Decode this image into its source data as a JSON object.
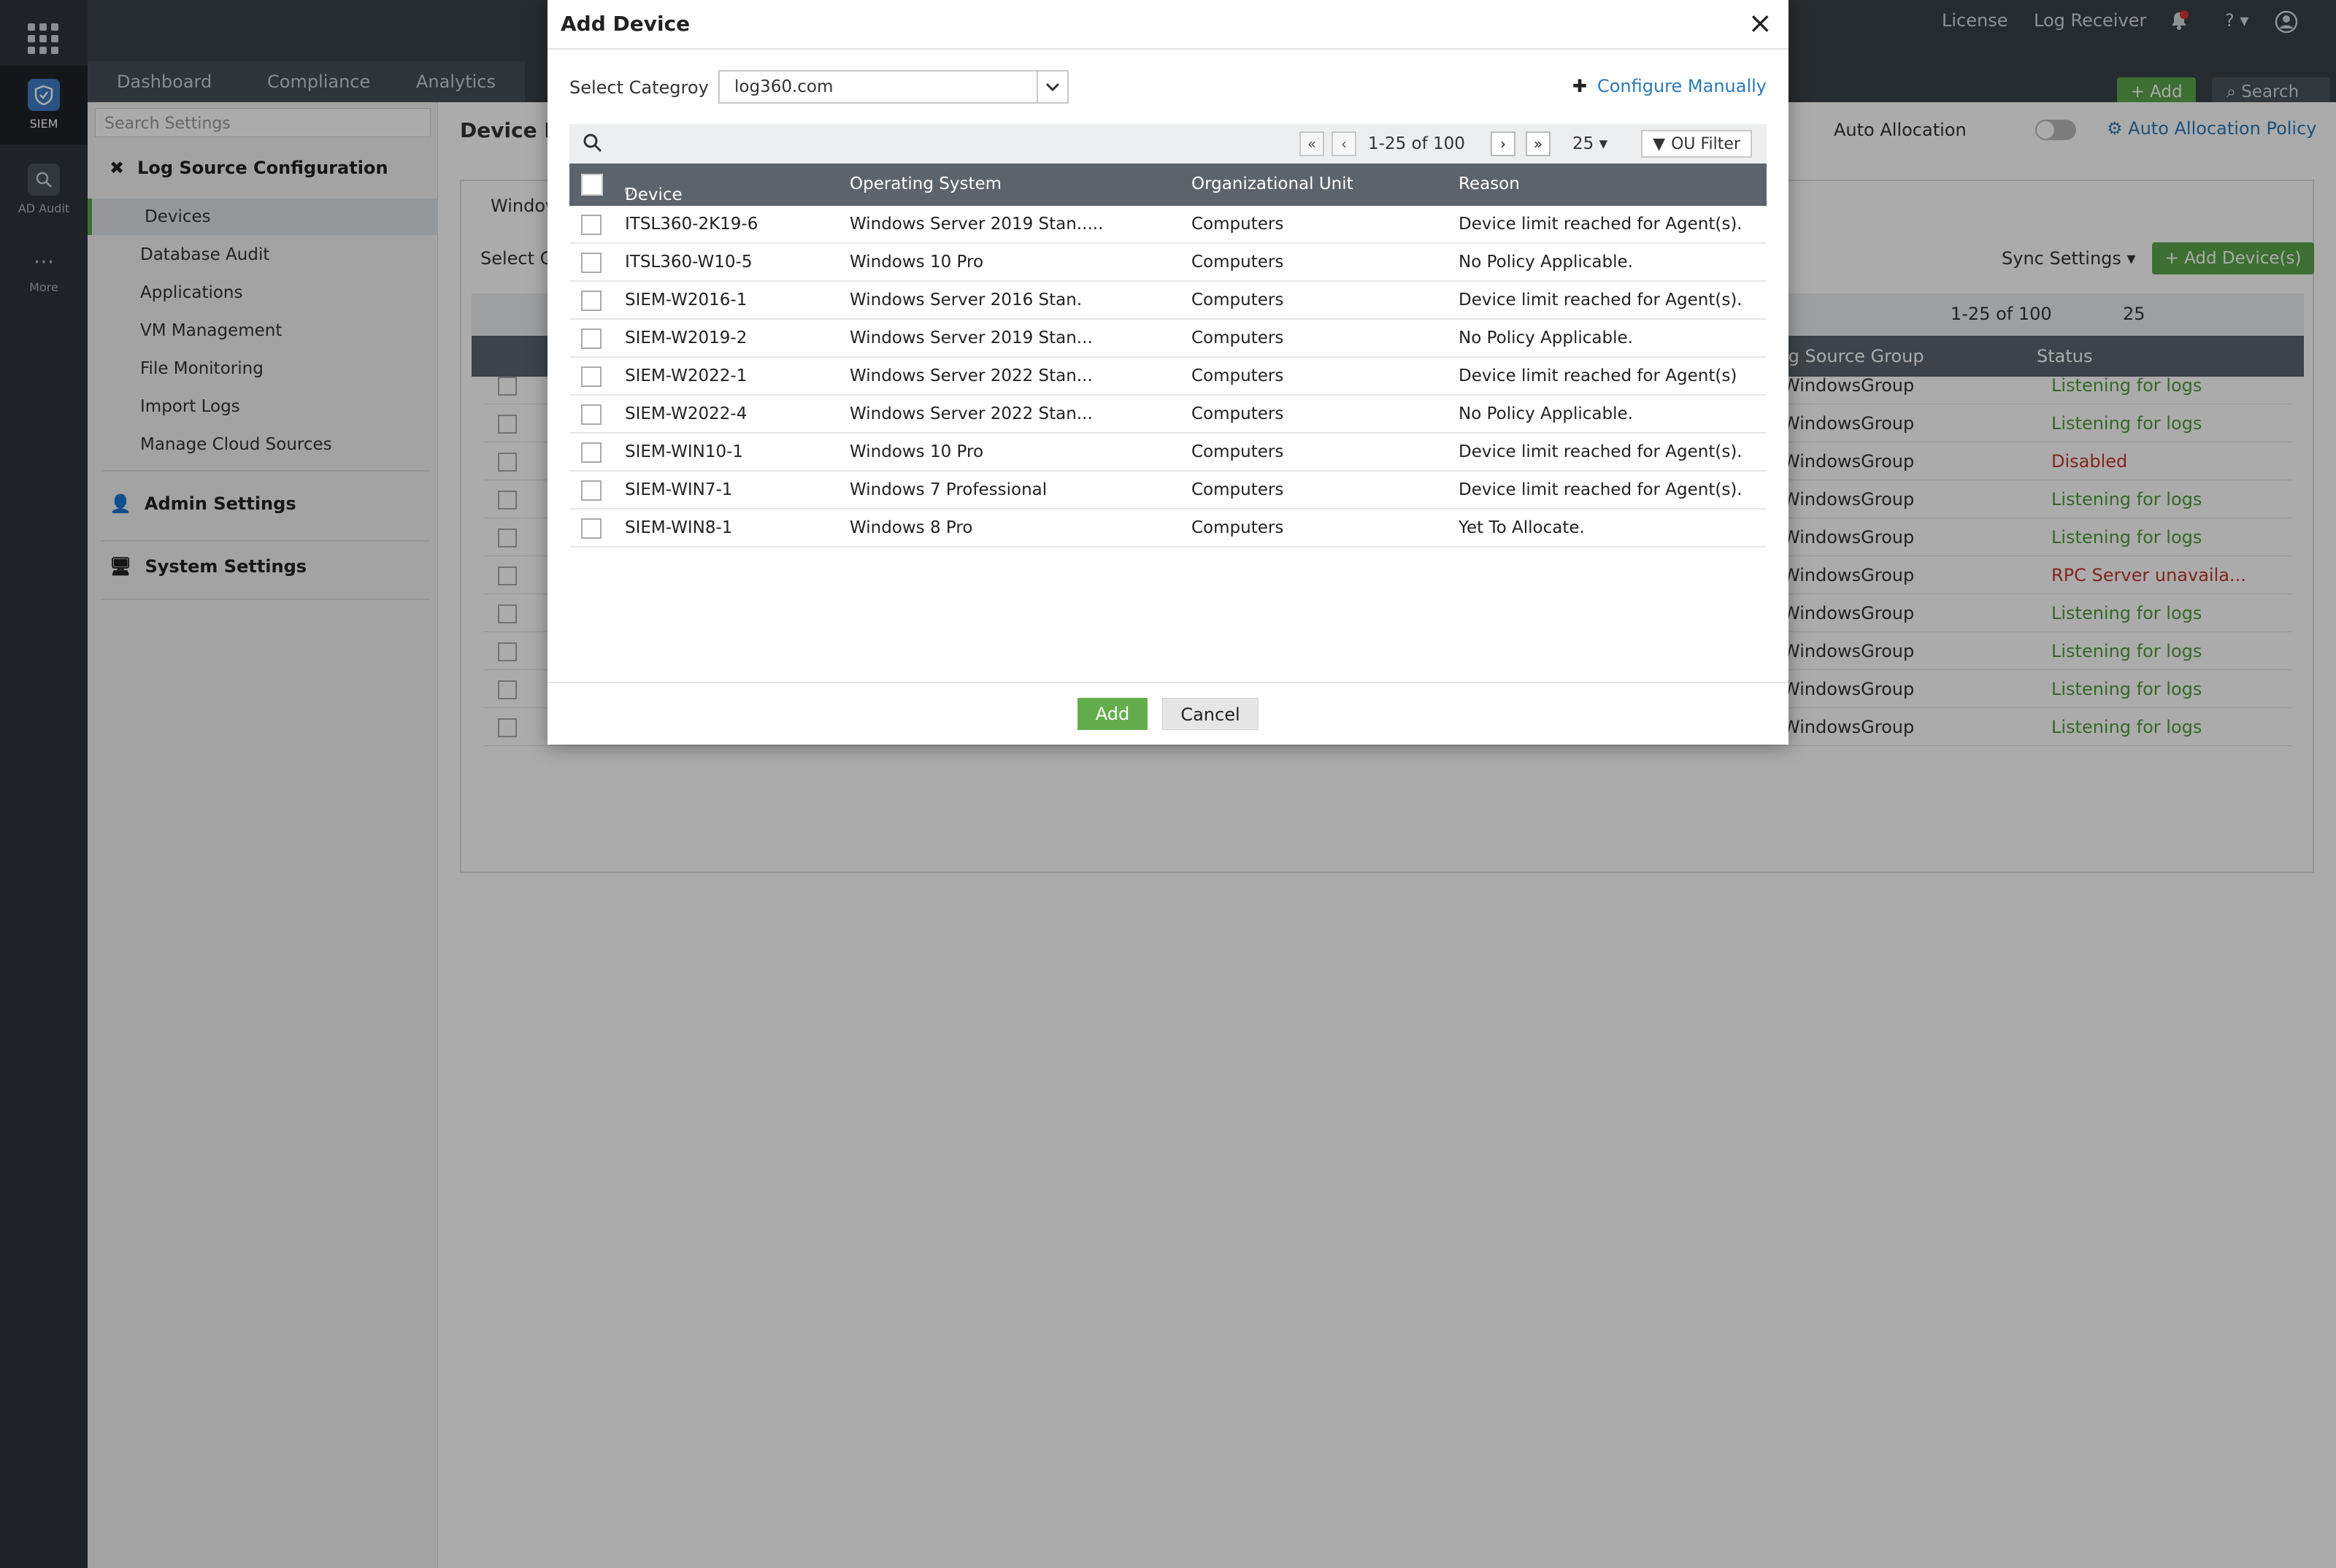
{
  "leftbar": {
    "siem": "SIEM",
    "ad_audit": "AD Audit",
    "more": "More"
  },
  "topbar": {
    "license": "License",
    "log_receiver": "Log Receiver",
    "notif_count": "2",
    "add": "Add",
    "search": "Search"
  },
  "nav_tabs": [
    "Dashboard",
    "Compliance",
    "Analytics"
  ],
  "sidebar": {
    "search_placeholder": "Search Settings",
    "log_source": "Log Source Configuration",
    "items": [
      "Devices",
      "Database Audit",
      "Applications",
      "VM Management",
      "File Monitoring",
      "Import Logs",
      "Manage Cloud Sources"
    ],
    "admin": "Admin Settings",
    "system": "System Settings"
  },
  "background": {
    "page_title": "Device Ma",
    "tab": "Window",
    "select_c": "Select C",
    "auto_allocation": "Auto Allocation",
    "auto_policy": "Auto Allocation Policy",
    "sync_settings": "Sync Settings",
    "add_devices": "Add Device(s)",
    "pagination": "1-25 of 100",
    "page_size": "25",
    "col_group": "Log Source Group",
    "col_status": "Status",
    "rows": [
      {
        "group": "WindowsGroup",
        "status": "Listening for logs",
        "ok": true
      },
      {
        "group": "WindowsGroup",
        "status": "Listening for logs",
        "ok": true
      },
      {
        "group": "WindowsGroup",
        "status": "Disabled",
        "ok": false
      },
      {
        "group": "WindowsGroup",
        "status": "Listening for logs",
        "ok": true
      },
      {
        "group": "WindowsGroup",
        "status": "Listening for logs",
        "ok": true
      },
      {
        "group": "WindowsGroup",
        "status": "RPC Server unavaila...",
        "ok": false
      },
      {
        "group": "WindowsGroup",
        "status": "Listening for logs",
        "ok": true
      },
      {
        "group": "WindowsGroup",
        "status": "Listening for logs",
        "ok": true
      },
      {
        "group": "WindowsGroup",
        "status": "Listening for logs",
        "ok": true
      },
      {
        "group": "WindowsGroup",
        "status": "Listening for logs",
        "ok": true
      }
    ]
  },
  "modal": {
    "title": "Add Device",
    "select_category_label": "Select Categroy",
    "category_value": "log360.com",
    "configure_manually": "Configure Manually",
    "pagination": "1-25 of 100",
    "page_size": "25",
    "ou_filter": "OU Filter",
    "columns": {
      "device": "Device",
      "os": "Operating System",
      "ou": "Organizational Unit",
      "reason": "Reason"
    },
    "rows": [
      {
        "device": "ITSL360-2K19-6",
        "os": "Windows Server 2019 Stan.....",
        "ou": "Computers",
        "reason": "Device limit reached for Agent(s)."
      },
      {
        "device": "ITSL360-W10-5",
        "os": "Windows 10 Pro",
        "ou": "Computers",
        "reason": "No Policy Applicable."
      },
      {
        "device": "SIEM-W2016-1",
        "os": "Windows Server 2016 Stan.",
        "ou": "Computers",
        "reason": "Device limit reached for Agent(s)."
      },
      {
        "device": "SIEM-W2019-2",
        "os": "Windows Server 2019 Stan...",
        "ou": "Computers",
        "reason": "No Policy Applicable."
      },
      {
        "device": "SIEM-W2022-1",
        "os": "Windows Server 2022 Stan...",
        "ou": "Computers",
        "reason": "Device limit reached for Agent(s)"
      },
      {
        "device": "SIEM-W2022-4",
        "os": "Windows Server 2022 Stan...",
        "ou": "Computers",
        "reason": "No Policy Applicable."
      },
      {
        "device": "SIEM-WIN10-1",
        "os": "Windows 10 Pro",
        "ou": "Computers",
        "reason": "Device limit reached for Agent(s)."
      },
      {
        "device": "SIEM-WIN7-1",
        "os": "Windows 7 Professional",
        "ou": "Computers",
        "reason": "Device limit reached for Agent(s)."
      },
      {
        "device": "SIEM-WIN8-1",
        "os": "Windows 8 Pro",
        "ou": "Computers",
        "reason": "Yet To Allocate."
      }
    ],
    "add_button": "Add",
    "cancel_button": "Cancel"
  },
  "colors": {
    "accent_green": "#5aa64a",
    "link_blue": "#2a7ab8",
    "error_red": "#c0392b"
  }
}
